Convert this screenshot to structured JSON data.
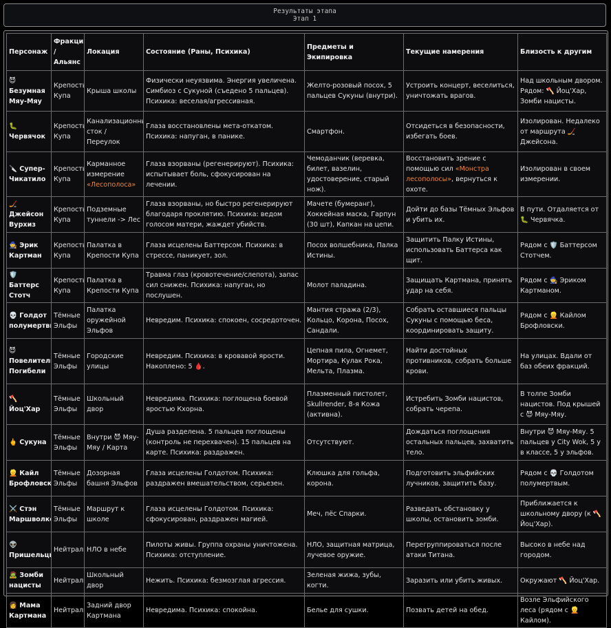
{
  "header": {
    "title": "Результаты этапа",
    "subtitle": "Этап 1"
  },
  "table": {
    "columns": [
      "Персонаж",
      "Фракция / Альянс",
      "Локация",
      "Состояние (Раны, Психика)",
      "Предметы и Экипировка",
      "Текущие намерения",
      "Близость к другим"
    ],
    "rows": [
      {
        "name": "😈 Безумная Мяу-Мяу",
        "faction": "Крепость Купа",
        "location": "Крыша школы",
        "state": "Физически неуязвима. Энергия увеличена. Симбиоз с Сукуной (съедено 5 пальцев). Психика: веселая/агрессивная.",
        "items": "Желто-розовый посох, 5 пальцев Сукуны (внутри).",
        "intent": "Устроить концерт, веселиться, уничтожать врагов.",
        "proximity": "Над школьным двором. Рядом: 🪓 Йоц'Хар, Зомби нацисты."
      },
      {
        "name": "🐛 Червячок",
        "faction": "Крепость Купа",
        "location": "Канализационный сток / Переулок",
        "state": "Глаза восстановлены мета-откатом. Психика: напуган, в панике.",
        "items": "Смартфон.",
        "intent": "Отсидеться в безопасности, избегать боев.",
        "proximity": "Изолирован. Недалеко от маршрута 🏒 Джейсона."
      },
      {
        "name": "🔪 Супер-Чикатило",
        "faction": "Крепость Купа",
        "location_pre": "Карманное измерение ",
        "location_hl": "«Лесополоса»",
        "state": "Глаза взорваны (регенерируют). Психика: испытывает боль, сфокусирован на лечении.",
        "items": "Чемоданчик (веревка, билет, вазелин, удостоверение, старый нож).",
        "intent_pre": "Восстановить зрение с помощью сил ",
        "intent_hl": "«Монстра лесополосы»",
        "intent_post": ", вернуться к охоте.",
        "proximity": "Изолирован в своем измерении."
      },
      {
        "name": "🏒 Джейсон Вурхиз",
        "faction": "Крепость Купа",
        "location": "Подземные туннели -> Лес",
        "state": "Глаза взорваны, но быстро регенерируют благодаря проклятию. Психика: ведом голосом матери, жаждет убийств.",
        "items": "Мачете (бумеранг), Хоккейная маска, Гарпун (30 шт), Капкан на цепи.",
        "intent": "Дойти до базы Тёмных Эльфов и убить их.",
        "proximity": "В пути. Отдаляется от 🐛 Червячка."
      },
      {
        "name": "🧙 Эрик Картман",
        "faction": "Крепость Купа",
        "location": "Палатка в Крепости Купа",
        "state": "Глаза исцелены Баттерсом. Психика: в стрессе, паникует, зол.",
        "items": "Посох волшебника, Палка Истины.",
        "intent": "Защитить Палку Истины, использовать Баттерса как щит.",
        "proximity": "Рядом с 🛡️ Баттерсом Стотчем."
      },
      {
        "name": "🛡️ Баттерс Стотч",
        "faction": "Крепость Купа",
        "location": "Палатка в Крепости Купа",
        "state": "Травма глаз (кровотечение/слепота), запас сил снижен. Психика: напуган, но послушен.",
        "items": "Молот паладина.",
        "intent": "Защищать Картмана, принять удар на себя.",
        "proximity": "Рядом с 🧙 Эриком Картманом."
      },
      {
        "name": "💀 Голдот полумертвый",
        "faction": "Тёмные Эльфы",
        "location": "Палатка оружейной Эльфов",
        "state": "Невредим. Психика: спокоен, сосредоточен.",
        "items": "Мантия стража (2/3), Кольцо, Корона, Посох, Сандали.",
        "intent": "Собрать оставшиеся пальцы Сукуны с помощью беса, координировать защиту.",
        "proximity": "Рядом с 👱 Кайлом Брофловски."
      },
      {
        "name": "😈 Повелитель Погибели",
        "faction": "Тёмные Эльфы",
        "location": "Городские улицы",
        "state": "Невредим. Психика: в кровавой ярости. Накоплено: 5 🩸.",
        "items": "Цепная пила, Огнемет, Мортира, Кулак Рока, Мельта, Плазма.",
        "intent": "Найти достойных противников, собрать больше крови.",
        "proximity": "На улицах. Вдали от баз обеих фракций."
      },
      {
        "name": "🪓 Йоц'Хар",
        "faction": "Тёмные Эльфы",
        "location": "Школьный двор",
        "state": "Невредима. Психика: поглощена боевой яростью Кхорна.",
        "items": "Плазменный пистолет, Skullrender, 8-я Кожа (активна).",
        "intent": "Истребить Зомби нацистов, собрать черепа.",
        "proximity": "В толпе Зомби нацистов. Под крышей с 😈 Мяу-Мяу."
      },
      {
        "name": "🖕 Сукуна",
        "faction": "Тёмные Эльфы",
        "location": "Внутри 😈 Мяу-Мяу / Карта",
        "state": "Душа разделена. 5 пальцев поглощены (контроль не перехвачен). 15 пальцев на карте. Психика: раздражен.",
        "items": "Отсутствуют.",
        "intent": "Дождаться поглощения остальных пальцев, захватить тело.",
        "proximity": "Внутри 😈 Мяу-Мяу. 5 пальцев у City Wok, 5 у в классе, 5 у эльфов."
      },
      {
        "name": "👱 Кайл Брофловски",
        "faction": "Тёмные Эльфы",
        "location": "Дозорная башня Эльфов",
        "state": "Глаза исцелены Голдотом. Психика: раздражен вмешательством, серьезен.",
        "items": "Клюшка для гольфа, корона.",
        "intent": "Подготовить эльфийских лучников, защитить базу.",
        "proximity": "Рядом с 💀 Голдотом полумертвым."
      },
      {
        "name": "⚔️ Стэн Маршволкер",
        "faction": "Тёмные Эльфы",
        "location": "Маршрут к школе",
        "state": "Глаза исцелены Голдотом. Психика: сфокусирован, раздражен магией.",
        "items": "Меч, пёс Спарки.",
        "intent": "Разведать обстановку у школы, остановить зомби.",
        "proximity": "Приближается к школьному двору (к 🪓 Йоц'Хар)."
      },
      {
        "name": "👽 Пришельцы",
        "faction": "Нейтральные",
        "location": "НЛО в небе",
        "state": "Пилоты живы. Группа охраны уничтожена. Психика: отступление.",
        "items": "НЛО, защитная матрица, лучевое оружие.",
        "intent": "Перегруппироваться после атаки Титана.",
        "proximity": "Высоко в небе над городом."
      },
      {
        "name": "🧟 Зомби нацисты",
        "faction": "Нейтральные",
        "location": "Школьный двор",
        "state": "Нежить. Психика: безмозглая агрессия.",
        "items": "Зеленая жижа, зубы, когти.",
        "intent": "Заразить или убить живых.",
        "proximity": "Окружают 🪓 Йоц'Хар."
      },
      {
        "name": "👩 Мама Картмана",
        "faction": "Нейтральные",
        "location": "Задний двор Картмана",
        "state": "Невредима. Психика: спокойна.",
        "items": "Белье для сушки.",
        "intent": "Позвать детей на обед.",
        "proximity": "Возле Эльфийского леса (рядом с 👱 Кайлом)."
      }
    ]
  }
}
